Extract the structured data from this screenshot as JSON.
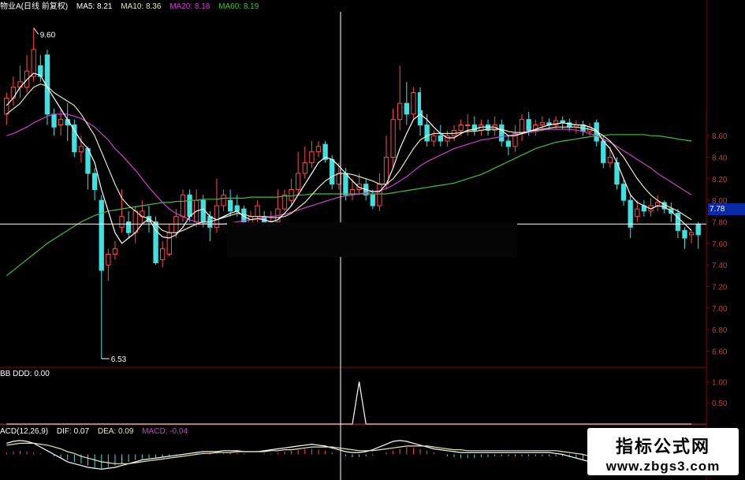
{
  "header": {
    "title": "物业A(日线 前复权)",
    "ma": [
      {
        "label": "MA5",
        "value": "8.21",
        "color": "#ffffff"
      },
      {
        "label": "MA10",
        "value": "8.36",
        "color": "#e8e8b0"
      },
      {
        "label": "MA20",
        "value": "8.18",
        "color": "#d040d0"
      },
      {
        "label": "MA60",
        "value": "8.19",
        "color": "#40c040"
      }
    ]
  },
  "sub1": {
    "title": "BB DDD: 0.00",
    "ticks": [
      "1.00",
      "0.50"
    ]
  },
  "sub2": {
    "title": "ACD(12,26,9)",
    "dif_label": "DIF: 0.07",
    "dea_label": "DEA: 0.09",
    "macd_label": "MACD: -0.04"
  },
  "price_labels": {
    "high": "9.60",
    "low": "6.53",
    "current": "7.78"
  },
  "watermark": {
    "line1": "指标公式网",
    "line2": "www.zbgs3.com"
  },
  "colors": {
    "up": "#ff4a4a",
    "down": "#40e0e0",
    "ma5": "#ffffff",
    "ma10": "#e8e8b0",
    "ma20": "#d040d0",
    "ma60": "#40c040",
    "grid_axis": "#8b0000"
  },
  "chart_data": {
    "type": "candlestick",
    "y_axis_ticks": [
      "8.60",
      "8.40",
      "8.20",
      "8.00",
      "7.80",
      "7.60",
      "7.40",
      "7.20",
      "7.00",
      "6.80",
      "6.60"
    ],
    "ylim": [
      6.45,
      9.75
    ],
    "candles": [
      [
        8.8,
        8.95,
        8.7,
        9.0
      ],
      [
        8.95,
        9.05,
        8.88,
        9.15
      ],
      [
        9.05,
        9.1,
        8.95,
        9.25
      ],
      [
        9.05,
        9.2,
        9.0,
        9.35
      ],
      [
        9.15,
        9.4,
        9.1,
        9.6
      ],
      [
        9.25,
        9.15,
        9.1,
        9.35
      ],
      [
        9.35,
        8.8,
        8.7,
        9.4
      ],
      [
        8.8,
        8.68,
        8.6,
        8.85
      ],
      [
        8.7,
        8.75,
        8.6,
        8.85
      ],
      [
        8.75,
        8.7,
        8.55,
        8.9
      ],
      [
        8.7,
        8.45,
        8.4,
        8.75
      ],
      [
        8.45,
        8.5,
        8.35,
        8.6
      ],
      [
        8.48,
        8.25,
        8.1,
        8.5
      ],
      [
        8.25,
        8.1,
        8.0,
        8.3
      ],
      [
        8.0,
        7.35,
        6.53,
        8.05
      ],
      [
        7.4,
        7.5,
        7.25,
        7.55
      ],
      [
        7.5,
        7.55,
        7.45,
        7.62
      ],
      [
        7.75,
        7.85,
        7.7,
        8.1
      ],
      [
        7.8,
        7.7,
        7.65,
        7.9
      ],
      [
        7.7,
        7.9,
        7.6,
        7.95
      ],
      [
        7.85,
        7.9,
        7.78,
        8.0
      ],
      [
        7.85,
        7.8,
        7.7,
        7.95
      ],
      [
        7.8,
        7.42,
        7.4,
        7.85
      ],
      [
        7.45,
        7.55,
        7.38,
        7.62
      ],
      [
        7.5,
        7.7,
        7.48,
        7.78
      ],
      [
        7.7,
        7.85,
        7.65,
        7.92
      ],
      [
        7.85,
        8.05,
        7.8,
        8.1
      ],
      [
        8.05,
        7.85,
        7.8,
        8.1
      ],
      [
        7.8,
        8.0,
        7.75,
        8.1
      ],
      [
        8.0,
        7.8,
        7.75,
        8.05
      ],
      [
        7.85,
        7.75,
        7.62,
        7.9
      ],
      [
        7.75,
        7.95,
        7.7,
        8.2
      ],
      [
        7.95,
        8.05,
        7.9,
        8.1
      ],
      [
        8.0,
        7.9,
        7.85,
        8.1
      ],
      [
        7.95,
        7.9,
        7.85,
        8.05
      ],
      [
        7.92,
        7.7,
        7.68,
        7.95
      ],
      [
        7.75,
        7.85,
        7.7,
        7.9
      ],
      [
        7.85,
        7.95,
        7.8,
        8.0
      ],
      [
        7.85,
        7.75,
        7.7,
        7.9
      ],
      [
        7.75,
        7.8,
        7.7,
        7.9
      ],
      [
        7.8,
        7.92,
        7.8,
        8.1
      ],
      [
        7.92,
        8.05,
        7.9,
        8.1
      ],
      [
        8.0,
        8.1,
        7.95,
        8.2
      ],
      [
        8.1,
        8.25,
        8.05,
        8.45
      ],
      [
        8.25,
        8.35,
        8.2,
        8.5
      ],
      [
        8.35,
        8.45,
        8.3,
        8.55
      ],
      [
        8.45,
        8.5,
        8.4,
        8.55
      ],
      [
        8.52,
        8.38,
        8.35,
        8.55
      ],
      [
        8.38,
        8.15,
        8.1,
        8.42
      ],
      [
        8.15,
        8.25,
        8.1,
        8.35
      ],
      [
        8.25,
        8.05,
        8.0,
        8.3
      ],
      [
        8.05,
        8.1,
        8.0,
        8.2
      ],
      [
        8.1,
        8.15,
        8.05,
        8.25
      ],
      [
        8.15,
        8.05,
        8.0,
        8.2
      ],
      [
        8.05,
        7.95,
        7.92,
        8.1
      ],
      [
        7.95,
        8.15,
        7.9,
        8.25
      ],
      [
        8.15,
        8.4,
        8.1,
        8.6
      ],
      [
        8.4,
        8.75,
        8.3,
        8.85
      ],
      [
        8.75,
        8.9,
        8.65,
        9.25
      ],
      [
        8.9,
        8.8,
        8.7,
        9.1
      ],
      [
        8.8,
        9.0,
        8.75,
        9.05
      ],
      [
        9.0,
        8.7,
        8.6,
        9.05
      ],
      [
        8.7,
        8.55,
        8.5,
        8.8
      ],
      [
        8.55,
        8.6,
        8.5,
        8.65
      ],
      [
        8.6,
        8.55,
        8.5,
        8.7
      ],
      [
        8.55,
        8.6,
        8.5,
        8.65
      ],
      [
        8.6,
        8.65,
        8.55,
        8.7
      ],
      [
        8.65,
        8.7,
        8.6,
        8.75
      ],
      [
        8.7,
        8.7,
        8.6,
        8.8
      ],
      [
        8.7,
        8.65,
        8.6,
        8.78
      ],
      [
        8.65,
        8.7,
        8.6,
        8.75
      ],
      [
        8.7,
        8.65,
        8.6,
        8.75
      ],
      [
        8.65,
        8.7,
        8.6,
        8.78
      ],
      [
        8.7,
        8.55,
        8.5,
        8.75
      ],
      [
        8.55,
        8.5,
        8.42,
        8.6
      ],
      [
        8.5,
        8.62,
        8.45,
        8.7
      ],
      [
        8.62,
        8.75,
        8.55,
        8.8
      ],
      [
        8.75,
        8.65,
        8.6,
        8.82
      ],
      [
        8.65,
        8.7,
        8.6,
        8.75
      ],
      [
        8.7,
        8.72,
        8.65,
        8.78
      ],
      [
        8.72,
        8.7,
        8.65,
        8.76
      ],
      [
        8.7,
        8.74,
        8.66,
        8.78
      ],
      [
        8.74,
        8.72,
        8.66,
        8.78
      ],
      [
        8.72,
        8.68,
        8.64,
        8.76
      ],
      [
        8.68,
        8.7,
        8.62,
        8.74
      ],
      [
        8.7,
        8.64,
        8.6,
        8.74
      ],
      [
        8.64,
        8.68,
        8.6,
        8.72
      ],
      [
        8.72,
        8.55,
        8.5,
        8.75
      ],
      [
        8.55,
        8.35,
        8.3,
        8.6
      ],
      [
        8.35,
        8.4,
        8.3,
        8.5
      ],
      [
        8.35,
        8.15,
        8.1,
        8.4
      ],
      [
        8.15,
        8.0,
        7.95,
        8.2
      ],
      [
        8.0,
        7.75,
        7.65,
        8.05
      ],
      [
        7.85,
        7.92,
        7.8,
        8.0
      ],
      [
        7.95,
        7.9,
        7.85,
        8.0
      ],
      [
        7.9,
        7.95,
        7.85,
        8.02
      ],
      [
        7.95,
        7.98,
        7.9,
        8.05
      ],
      [
        7.98,
        7.92,
        7.88,
        8.0
      ],
      [
        7.92,
        7.88,
        7.8,
        7.98
      ],
      [
        7.88,
        7.72,
        7.65,
        7.92
      ],
      [
        7.72,
        7.65,
        7.55,
        7.75
      ],
      [
        7.68,
        7.7,
        7.6,
        7.72
      ],
      [
        7.78,
        7.68,
        7.55,
        7.8
      ]
    ],
    "ma5": [
      8.88,
      8.95,
      9.05,
      9.12,
      9.18,
      9.16,
      9.05,
      8.95,
      8.85,
      8.75,
      8.65,
      8.55,
      8.48,
      8.35,
      8.1,
      7.9,
      7.7,
      7.6,
      7.65,
      7.7,
      7.78,
      7.83,
      7.72,
      7.66,
      7.65,
      7.68,
      7.75,
      7.85,
      7.9,
      7.92,
      7.85,
      7.82,
      7.85,
      7.88,
      7.9,
      7.85,
      7.82,
      7.83,
      7.82,
      7.8,
      7.82,
      7.88,
      7.95,
      8.05,
      8.15,
      8.25,
      8.35,
      8.4,
      8.38,
      8.32,
      8.25,
      8.18,
      8.12,
      8.1,
      8.08,
      8.08,
      8.15,
      8.3,
      8.48,
      8.62,
      8.75,
      8.8,
      8.75,
      8.68,
      8.62,
      8.58,
      8.58,
      8.62,
      8.65,
      8.66,
      8.68,
      8.68,
      8.68,
      8.65,
      8.6,
      8.6,
      8.62,
      8.64,
      8.66,
      8.68,
      8.7,
      8.71,
      8.72,
      8.71,
      8.7,
      8.7,
      8.68,
      8.65,
      8.55,
      8.48,
      8.35,
      8.2,
      8.05,
      7.98,
      7.95,
      7.92,
      7.95,
      7.94,
      7.9,
      7.84,
      7.78,
      7.72
    ],
    "ma10": [
      8.8,
      8.85,
      8.9,
      8.98,
      9.05,
      9.08,
      9.06,
      9.0,
      8.96,
      8.92,
      8.88,
      8.8,
      8.7,
      8.6,
      8.45,
      8.3,
      8.15,
      8.02,
      7.95,
      7.9,
      7.85,
      7.83,
      7.78,
      7.72,
      7.7,
      7.7,
      7.72,
      7.75,
      7.78,
      7.8,
      7.8,
      7.82,
      7.84,
      7.86,
      7.88,
      7.87,
      7.85,
      7.85,
      7.85,
      7.84,
      7.84,
      7.85,
      7.88,
      7.93,
      7.98,
      8.05,
      8.12,
      8.18,
      8.22,
      8.25,
      8.25,
      8.24,
      8.22,
      8.2,
      8.18,
      8.15,
      8.15,
      8.2,
      8.28,
      8.38,
      8.48,
      8.56,
      8.6,
      8.62,
      8.62,
      8.62,
      8.62,
      8.63,
      8.64,
      8.64,
      8.65,
      8.66,
      8.66,
      8.66,
      8.64,
      8.63,
      8.63,
      8.64,
      8.65,
      8.66,
      8.67,
      8.68,
      8.68,
      8.68,
      8.68,
      8.67,
      8.66,
      8.64,
      8.6,
      8.55,
      8.48,
      8.4,
      8.3,
      8.2,
      8.12,
      8.05,
      8.0,
      7.96,
      7.93,
      7.9,
      7.86,
      7.82
    ],
    "ma20": [
      8.6,
      8.62,
      8.65,
      8.68,
      8.72,
      8.75,
      8.78,
      8.8,
      8.8,
      8.8,
      8.78,
      8.76,
      8.72,
      8.68,
      8.62,
      8.56,
      8.48,
      8.42,
      8.35,
      8.28,
      8.2,
      8.12,
      8.05,
      7.98,
      7.92,
      7.88,
      7.85,
      7.82,
      7.8,
      7.79,
      7.78,
      7.78,
      7.78,
      7.79,
      7.8,
      7.81,
      7.82,
      7.83,
      7.84,
      7.85,
      7.86,
      7.87,
      7.89,
      7.91,
      7.93,
      7.95,
      7.97,
      7.99,
      8.01,
      8.03,
      8.04,
      8.05,
      8.06,
      8.07,
      8.08,
      8.09,
      8.11,
      8.14,
      8.18,
      8.22,
      8.27,
      8.32,
      8.36,
      8.39,
      8.42,
      8.45,
      8.48,
      8.5,
      8.52,
      8.54,
      8.56,
      8.57,
      8.58,
      8.59,
      8.6,
      8.61,
      8.62,
      8.63,
      8.64,
      8.65,
      8.66,
      8.66,
      8.66,
      8.66,
      8.65,
      8.64,
      8.62,
      8.6,
      8.57,
      8.54,
      8.5,
      8.46,
      8.42,
      8.38,
      8.34,
      8.3,
      8.25,
      8.21,
      8.17,
      8.13,
      8.09,
      8.05
    ],
    "ma60": [
      7.3,
      7.35,
      7.4,
      7.45,
      7.5,
      7.55,
      7.6,
      7.64,
      7.68,
      7.72,
      7.76,
      7.8,
      7.83,
      7.86,
      7.88,
      7.9,
      7.91,
      7.92,
      7.93,
      7.94,
      7.95,
      7.96,
      7.97,
      7.98,
      7.98,
      7.99,
      7.99,
      8.0,
      8.0,
      8.01,
      8.01,
      8.01,
      8.02,
      8.02,
      8.02,
      8.02,
      8.03,
      8.03,
      8.03,
      8.03,
      8.03,
      8.04,
      8.04,
      8.05,
      8.05,
      8.06,
      8.06,
      8.06,
      8.06,
      8.06,
      8.06,
      8.06,
      8.06,
      8.06,
      8.06,
      8.06,
      8.06,
      8.07,
      8.08,
      8.09,
      8.1,
      8.11,
      8.12,
      8.13,
      8.14,
      8.15,
      8.16,
      8.18,
      8.2,
      8.22,
      8.24,
      8.27,
      8.3,
      8.33,
      8.36,
      8.39,
      8.42,
      8.45,
      8.48,
      8.5,
      8.52,
      8.54,
      8.55,
      8.56,
      8.57,
      8.58,
      8.59,
      8.6,
      8.6,
      8.61,
      8.61,
      8.61,
      8.61,
      8.61,
      8.61,
      8.6,
      8.6,
      8.59,
      8.58,
      8.57,
      8.56,
      8.55
    ],
    "bb_ddd": [
      0,
      0,
      0,
      0,
      0,
      0,
      0,
      0,
      0,
      0,
      0,
      0,
      0,
      0,
      0,
      0,
      0,
      0,
      0,
      0,
      0,
      0,
      0,
      0,
      0,
      0,
      0,
      0,
      0,
      0,
      0,
      0,
      0,
      0,
      0,
      0,
      0,
      0,
      0,
      0,
      0,
      0,
      0,
      0,
      0,
      0,
      0,
      0,
      0,
      0,
      0,
      0,
      1.0,
      0,
      0,
      0,
      0,
      0,
      0,
      0,
      0,
      0,
      0,
      0,
      0,
      0,
      0,
      0,
      0,
      0,
      0,
      0,
      0,
      0,
      0,
      0,
      0,
      0,
      0,
      0,
      0,
      0,
      0,
      0,
      0,
      0,
      0,
      0,
      0,
      0,
      0,
      0,
      0,
      0,
      0,
      0,
      0,
      0,
      0,
      0,
      0,
      0
    ],
    "bb_ylim": [
      0,
      1.1
    ],
    "macd_hist": [
      0.02,
      0.03,
      0.04,
      0.03,
      0.02,
      0.01,
      0.0,
      -0.02,
      -0.04,
      -0.06,
      -0.08,
      -0.1,
      -0.12,
      -0.14,
      -0.16,
      -0.14,
      -0.12,
      -0.1,
      -0.08,
      -0.06,
      -0.05,
      -0.04,
      -0.04,
      -0.03,
      -0.02,
      -0.01,
      0.0,
      0.01,
      0.02,
      0.02,
      0.02,
      0.01,
      0.01,
      0.02,
      0.02,
      0.01,
      0.0,
      0.0,
      0.01,
      0.01,
      0.02,
      0.03,
      0.04,
      0.05,
      0.06,
      0.06,
      0.05,
      0.04,
      0.02,
      0.0,
      -0.02,
      -0.03,
      -0.03,
      -0.02,
      -0.01,
      0.0,
      0.02,
      0.04,
      0.06,
      0.08,
      0.07,
      0.06,
      0.04,
      0.02,
      0.0,
      -0.02,
      -0.03,
      -0.04,
      -0.04,
      -0.04,
      -0.03,
      -0.03,
      -0.02,
      -0.02,
      -0.02,
      -0.02,
      -0.02,
      -0.02,
      -0.02,
      -0.02,
      -0.02,
      -0.02,
      -0.02,
      -0.03,
      -0.04,
      -0.06,
      -0.08,
      -0.09,
      -0.1,
      -0.1,
      -0.1,
      -0.08,
      -0.06,
      -0.05,
      -0.04,
      -0.04,
      -0.04,
      -0.04,
      -0.04,
      -0.04,
      -0.04,
      -0.04
    ],
    "macd_dif": [
      0.12,
      0.14,
      0.15,
      0.14,
      0.12,
      0.08,
      0.04,
      0.0,
      -0.04,
      -0.08,
      -0.1,
      -0.12,
      -0.14,
      -0.15,
      -0.16,
      -0.15,
      -0.14,
      -0.12,
      -0.1,
      -0.08,
      -0.06,
      -0.05,
      -0.04,
      -0.03,
      -0.02,
      -0.01,
      0.0,
      0.01,
      0.02,
      0.03,
      0.03,
      0.03,
      0.04,
      0.04,
      0.04,
      0.03,
      0.03,
      0.03,
      0.04,
      0.05,
      0.06,
      0.07,
      0.08,
      0.09,
      0.1,
      0.11,
      0.1,
      0.09,
      0.07,
      0.05,
      0.03,
      0.02,
      0.02,
      0.03,
      0.05,
      0.08,
      0.11,
      0.14,
      0.15,
      0.14,
      0.12,
      0.1,
      0.08,
      0.06,
      0.05,
      0.04,
      0.03,
      0.02,
      0.02,
      0.02,
      0.02,
      0.02,
      0.02,
      0.02,
      0.02,
      0.02,
      0.02,
      0.02,
      0.02,
      0.02,
      0.02,
      0.01,
      0.0,
      -0.02,
      -0.04,
      -0.06,
      -0.08,
      -0.09,
      -0.1,
      -0.1,
      -0.09,
      -0.08,
      -0.06,
      -0.04,
      -0.02,
      0.0,
      0.02,
      0.04,
      0.05,
      0.06,
      0.07,
      0.07
    ],
    "macd_dea": [
      0.1,
      0.11,
      0.12,
      0.12,
      0.12,
      0.11,
      0.1,
      0.08,
      0.06,
      0.03,
      0.01,
      -0.02,
      -0.04,
      -0.06,
      -0.08,
      -0.09,
      -0.1,
      -0.1,
      -0.1,
      -0.09,
      -0.08,
      -0.07,
      -0.06,
      -0.05,
      -0.04,
      -0.03,
      -0.02,
      -0.01,
      0.0,
      0.01,
      0.01,
      0.02,
      0.02,
      0.02,
      0.03,
      0.03,
      0.03,
      0.03,
      0.03,
      0.04,
      0.04,
      0.05,
      0.05,
      0.06,
      0.07,
      0.08,
      0.08,
      0.08,
      0.08,
      0.07,
      0.06,
      0.05,
      0.04,
      0.04,
      0.04,
      0.05,
      0.06,
      0.07,
      0.08,
      0.09,
      0.09,
      0.09,
      0.09,
      0.08,
      0.07,
      0.06,
      0.05,
      0.05,
      0.04,
      0.04,
      0.04,
      0.04,
      0.04,
      0.04,
      0.04,
      0.04,
      0.04,
      0.04,
      0.04,
      0.04,
      0.04,
      0.04,
      0.03,
      0.02,
      0.01,
      0.0,
      -0.02,
      -0.03,
      -0.04,
      -0.05,
      -0.05,
      -0.05,
      -0.05,
      -0.04,
      -0.03,
      -0.02,
      0.0,
      0.02,
      0.04,
      0.06,
      0.08,
      0.09
    ],
    "macd_ylim": [
      -0.2,
      0.2
    ]
  }
}
